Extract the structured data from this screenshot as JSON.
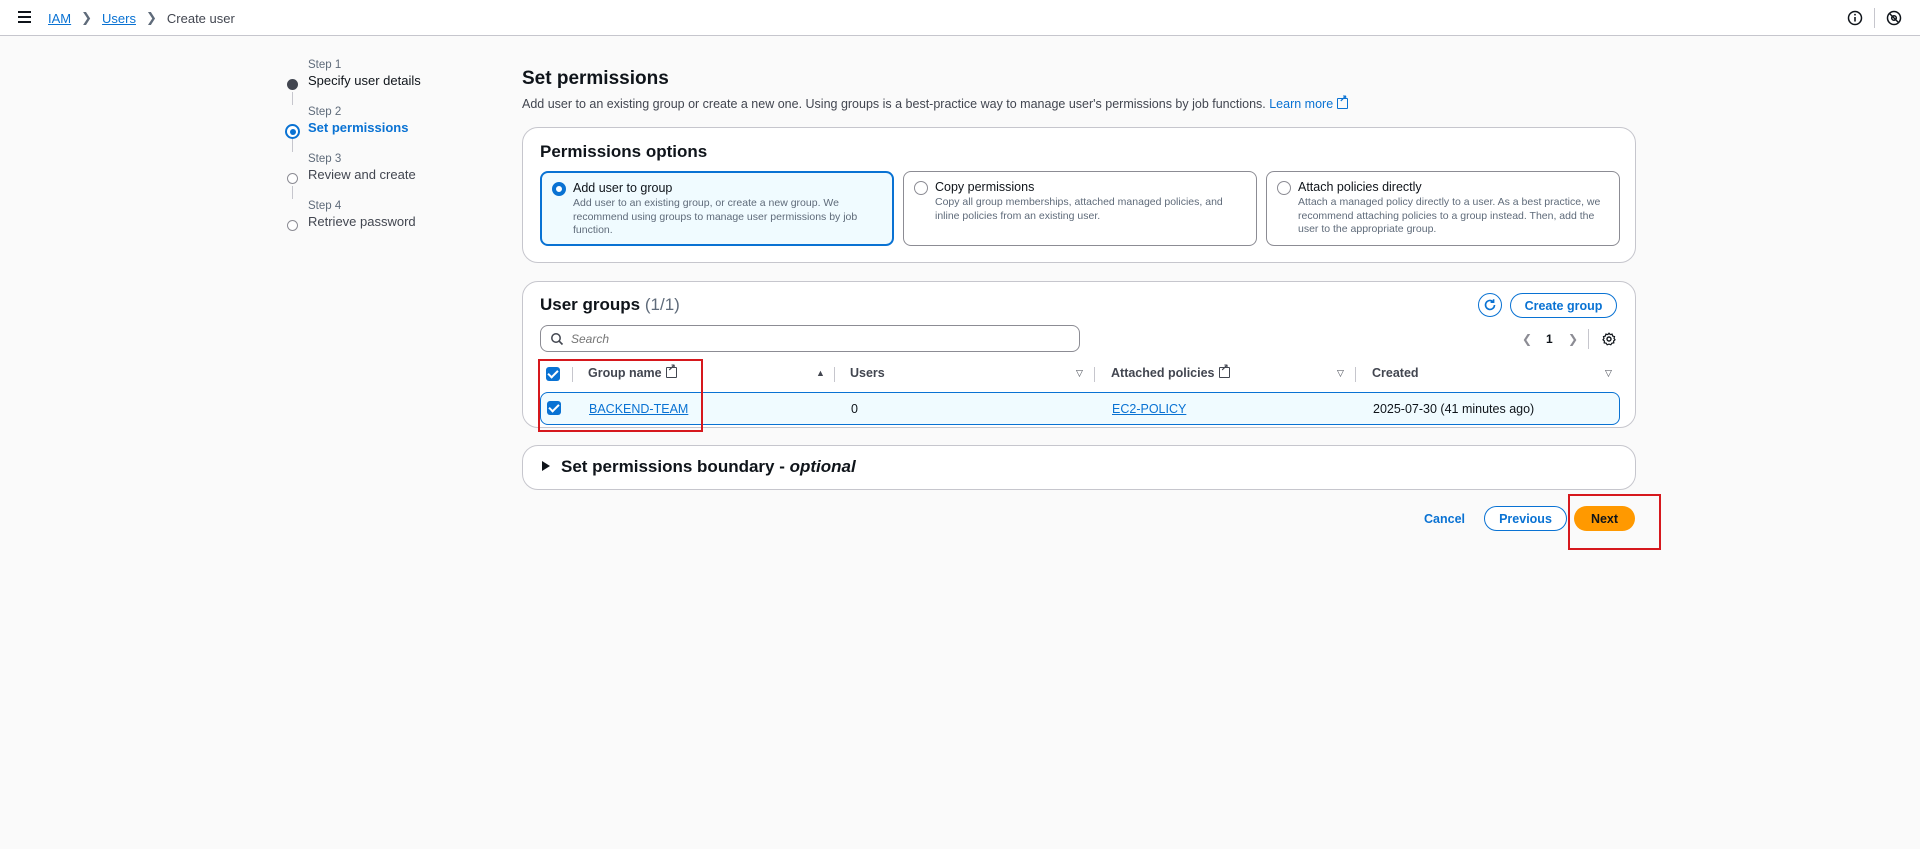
{
  "topbar": {
    "breadcrumb": [
      "IAM",
      "Users",
      "Create user"
    ],
    "icons": [
      "menu-icon",
      "info-icon",
      "settings-icon"
    ]
  },
  "steps": [
    {
      "num": "Step 1",
      "title": "Specify user details",
      "state": "done"
    },
    {
      "num": "Step 2",
      "title": "Set permissions",
      "state": "active"
    },
    {
      "num": "Step 3",
      "title": "Review and create",
      "state": "pending"
    },
    {
      "num": "Step 4",
      "title": "Retrieve password",
      "state": "pending"
    }
  ],
  "page": {
    "title": "Set permissions",
    "description": "Add user to an existing group or create a new one. Using groups is a best-practice way to manage user's permissions by job functions.",
    "learn_more": "Learn more"
  },
  "permissions_options": {
    "title": "Permissions options",
    "options": [
      {
        "label": "Add user to group",
        "description": "Add user to an existing group, or create a new group. We recommend using groups to manage user permissions by job function.",
        "selected": true
      },
      {
        "label": "Copy permissions",
        "description": "Copy all group memberships, attached managed policies, and inline policies from an existing user.",
        "selected": false
      },
      {
        "label": "Attach policies directly",
        "description": "Attach a managed policy directly to a user. As a best practice, we recommend attaching policies to a group instead. Then, add the user to the appropriate group.",
        "selected": false
      }
    ]
  },
  "user_groups": {
    "title": "User groups",
    "count": "(1/1)",
    "create_group_label": "Create group",
    "search_placeholder": "Search",
    "page_number": "1",
    "columns": [
      "Group name",
      "Users",
      "Attached policies",
      "Created"
    ],
    "rows": [
      {
        "group_name": "BACKEND-TEAM",
        "users": "0",
        "attached_policies": "EC2-POLICY",
        "created": "2025-07-30 (41 minutes ago)",
        "selected": true
      }
    ]
  },
  "boundary": {
    "title": "Set permissions boundary - ",
    "optional": "optional"
  },
  "footer": {
    "cancel": "Cancel",
    "previous": "Previous",
    "next": "Next"
  },
  "colors": {
    "accent": "#0972d3",
    "primary_button": "#ff9900",
    "highlight": "#d6181d"
  }
}
